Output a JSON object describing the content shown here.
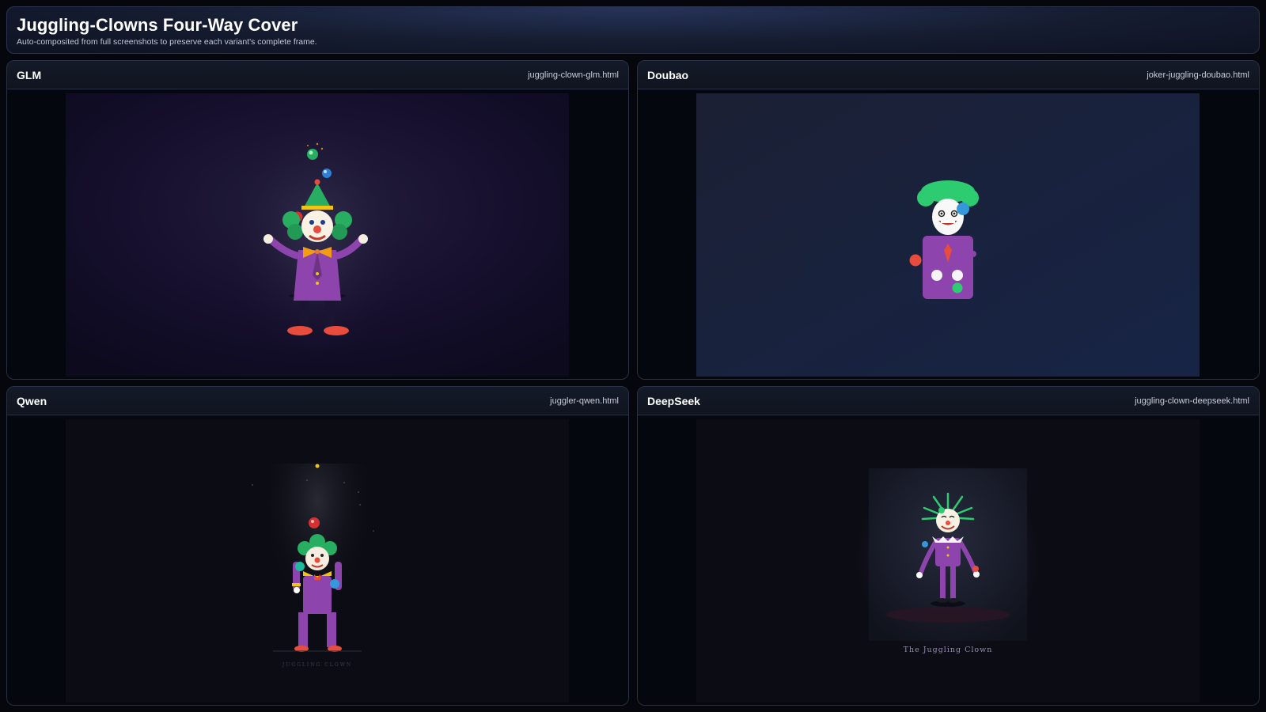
{
  "header": {
    "title": "Juggling-Clowns Four-Way Cover",
    "subtitle": "Auto-composited from full screenshots to preserve each variant's complete frame."
  },
  "panels": [
    {
      "title": "GLM",
      "file": "juggling-clown-glm.html"
    },
    {
      "title": "Doubao",
      "file": "joker-juggling-doubao.html"
    },
    {
      "title": "Qwen",
      "file": "juggler-qwen.html",
      "caption": "JUGGLING CLOWN"
    },
    {
      "title": "DeepSeek",
      "file": "juggling-clown-deepseek.html",
      "caption": "The Juggling Clown"
    }
  ],
  "colors": {
    "page_bg": "#05070d",
    "clown_purple": "#8e44ad",
    "hair_green": "#2ecc71",
    "nose_red": "#e74c3c",
    "ball_blue": "#3498db"
  }
}
